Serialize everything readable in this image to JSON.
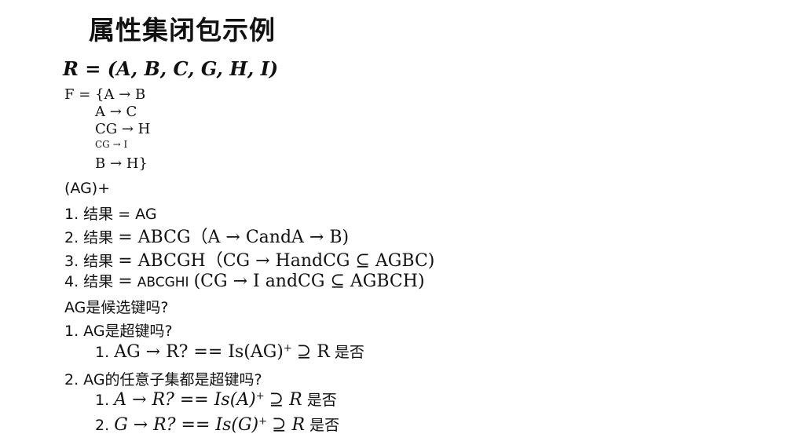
{
  "title": "属性集闭包示例",
  "relation": "R = (A, B, C, G, H, I)",
  "fds": {
    "f1": "F = {A → B",
    "f2": "A → C",
    "f3": "CG → H",
    "f4": "CG → I",
    "f5": "B → H}"
  },
  "lines": {
    "closure_label": "(AG)+",
    "step1": "1. 结果 = AG",
    "step2_prefix": "2. 结果",
    "step2_math": "= ABCG（A → CandA → B)",
    "step3_prefix": "3. 结果",
    "step3_math": "= ABCGH（CG → HandCG ⊆ AGBC)",
    "step4_prefix": "4. 结果",
    "step4_eq": "=",
    "step4_mid": "ABCGHI",
    "step4_math": "(CG → I andCG ⊆ AGBCH)",
    "question": "AG是候选键吗?",
    "q1": "1. AG是超键吗?",
    "q1a_num": "1.",
    "q1a_math": "AG → R? == Is(AG)",
    "q1a_sup": "+",
    "q1a_tail": "⊇ R",
    "q1a_word": "是否",
    "q2": "2. AG的任意子集都是超键吗?",
    "q2a_num": "1.",
    "q2a_math": "A → R? == Is(A)",
    "q2a_sup": "+",
    "q2a_tail": "⊇ R",
    "q2a_word": "是否",
    "q2b_num": "2.",
    "q2b_math": "G → R? == Is(G)",
    "q2b_sup": "+",
    "q2b_tail": "⊇ R",
    "q2b_word": "是否"
  }
}
